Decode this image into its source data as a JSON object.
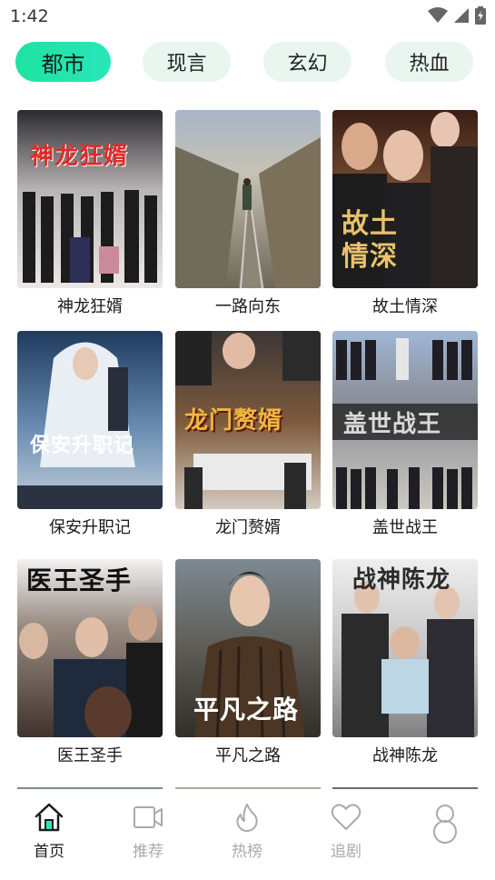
{
  "status_bar": {
    "time": "1:42"
  },
  "categories": [
    {
      "label": "都市",
      "active": true
    },
    {
      "label": "现言",
      "active": false
    },
    {
      "label": "玄幻",
      "active": false
    },
    {
      "label": "热血",
      "active": false
    }
  ],
  "dramas": [
    {
      "title": "神龙狂婿",
      "poster_text": "神龙狂婿"
    },
    {
      "title": "一路向东",
      "poster_text": ""
    },
    {
      "title": "故土情深",
      "poster_text": "故土情深"
    },
    {
      "title": "保安升职记",
      "poster_text": "保安升职记"
    },
    {
      "title": "龙门赘婿",
      "poster_text": "龙门赘婿"
    },
    {
      "title": "盖世战王",
      "poster_text": "盖世战王"
    },
    {
      "title": "医王圣手",
      "poster_text": "医王圣手"
    },
    {
      "title": "平凡之路",
      "poster_text": "平凡之路"
    },
    {
      "title": "战神陈龙",
      "poster_text": "战神陈龙"
    }
  ],
  "bottom_nav": [
    {
      "label": "首页",
      "icon": "home-icon",
      "active": true
    },
    {
      "label": "推荐",
      "icon": "video-camera-icon",
      "active": false
    },
    {
      "label": "热榜",
      "icon": "flame-icon",
      "active": false
    },
    {
      "label": "追剧",
      "icon": "heart-icon",
      "active": false
    },
    {
      "label": "",
      "icon": "profile-icon",
      "active": false
    }
  ],
  "colors": {
    "accent_start": "#1fe2a0",
    "accent_end": "#27e7b9",
    "tab_bg": "#e8f6ef",
    "inactive_text": "#aaaaaa"
  }
}
